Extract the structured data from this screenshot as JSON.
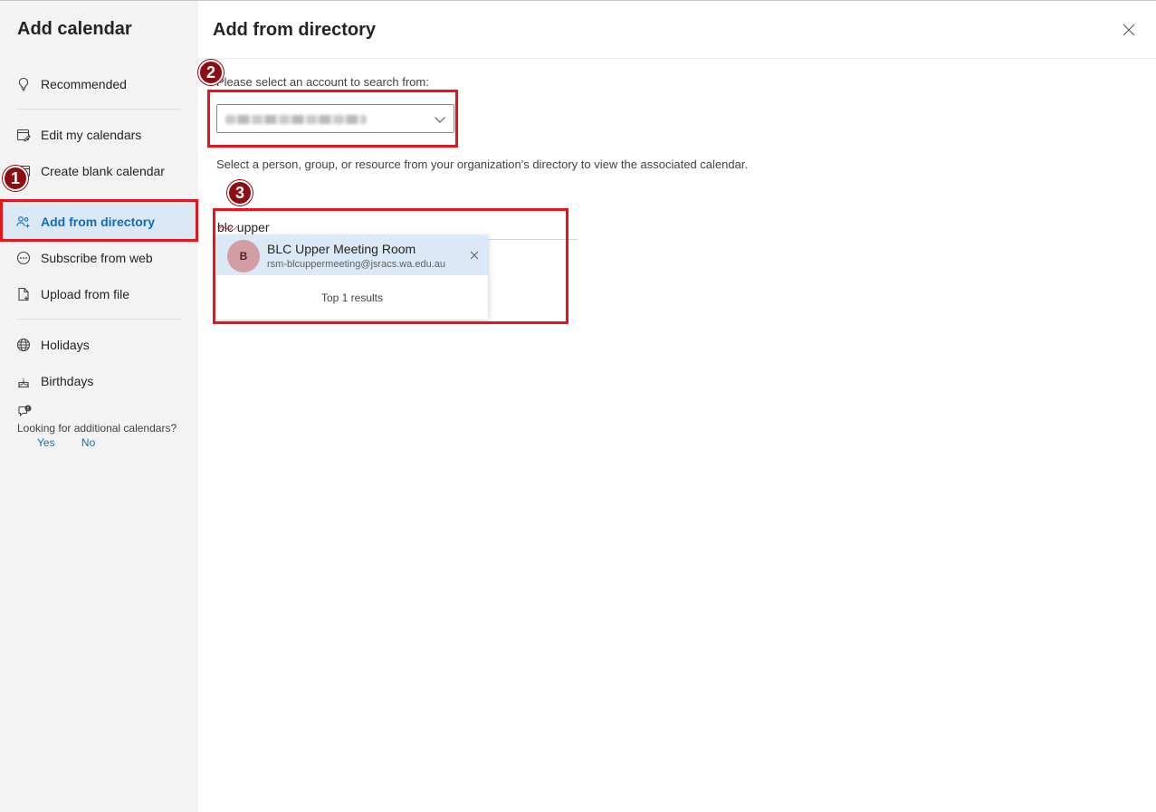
{
  "sidebar": {
    "title": "Add calendar",
    "items": [
      {
        "label": "Recommended",
        "icon": "lightbulb-icon"
      },
      {
        "label": "Edit my calendars",
        "icon": "edit-calendar-icon"
      },
      {
        "label": "Create blank calendar",
        "icon": "calendar-add-icon"
      },
      {
        "label": "Add from directory",
        "icon": "people-add-icon",
        "active": true
      },
      {
        "label": "Subscribe from web",
        "icon": "link-circle-icon"
      },
      {
        "label": "Upload from file",
        "icon": "document-add-icon"
      },
      {
        "label": "Holidays",
        "icon": "globe-icon"
      },
      {
        "label": "Birthdays",
        "icon": "cake-icon"
      }
    ],
    "feedback": {
      "question": "Looking for additional calendars?",
      "yes": "Yes",
      "no": "No"
    }
  },
  "main": {
    "title": "Add from directory",
    "account_prompt": "Please select an account to search from:",
    "description": "Select a person, group, or resource from your organization's directory to view the associated calendar.",
    "search_value": "blc upper",
    "suggestion": {
      "initial": "B",
      "name": "BLC Upper Meeting Room",
      "email": "rsm-blcuppermeeting@jsracs.wa.edu.au"
    },
    "results_footer": "Top 1 results"
  },
  "annotations": {
    "badges": [
      "1",
      "2",
      "3"
    ],
    "color": "#e8141c",
    "badge_color": "#8e0d12"
  },
  "colors": {
    "accent": "#0f6cbd",
    "selected_bg": "#dbe8f5",
    "sidebar_bg": "#f3f3f3"
  }
}
